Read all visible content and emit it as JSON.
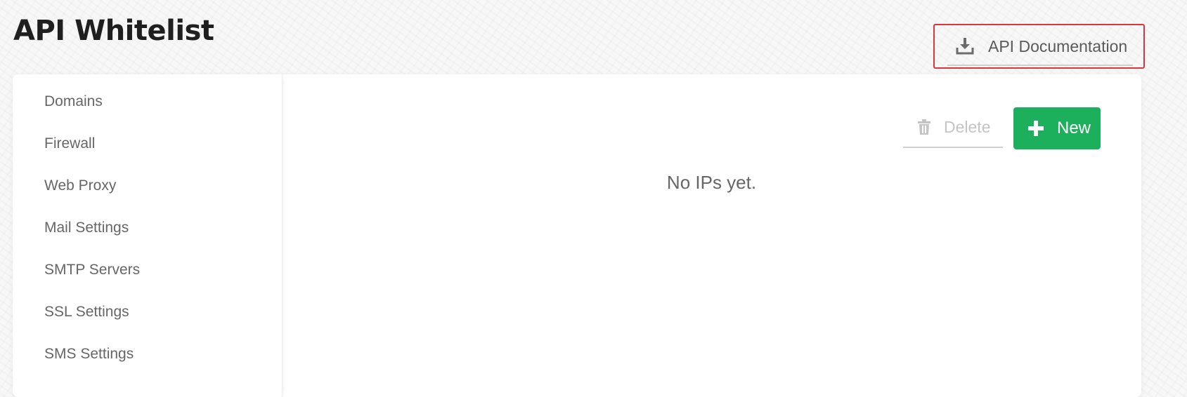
{
  "header": {
    "title": "API Whitelist",
    "doc_button": {
      "label": "API Documentation",
      "icon": "download-icon"
    }
  },
  "sidebar": {
    "items": [
      {
        "label": "Domains"
      },
      {
        "label": "Firewall"
      },
      {
        "label": "Web Proxy"
      },
      {
        "label": "Mail Settings"
      },
      {
        "label": "SMTP Servers"
      },
      {
        "label": "SSL Settings"
      },
      {
        "label": "SMS Settings"
      }
    ]
  },
  "toolbar": {
    "delete_label": "Delete",
    "delete_icon": "trash-icon",
    "new_label": "New",
    "new_icon": "plus-icon"
  },
  "main": {
    "empty_text": "No IPs yet."
  },
  "colors": {
    "accent_green": "#1db05c",
    "highlight_border": "#d9363e"
  }
}
